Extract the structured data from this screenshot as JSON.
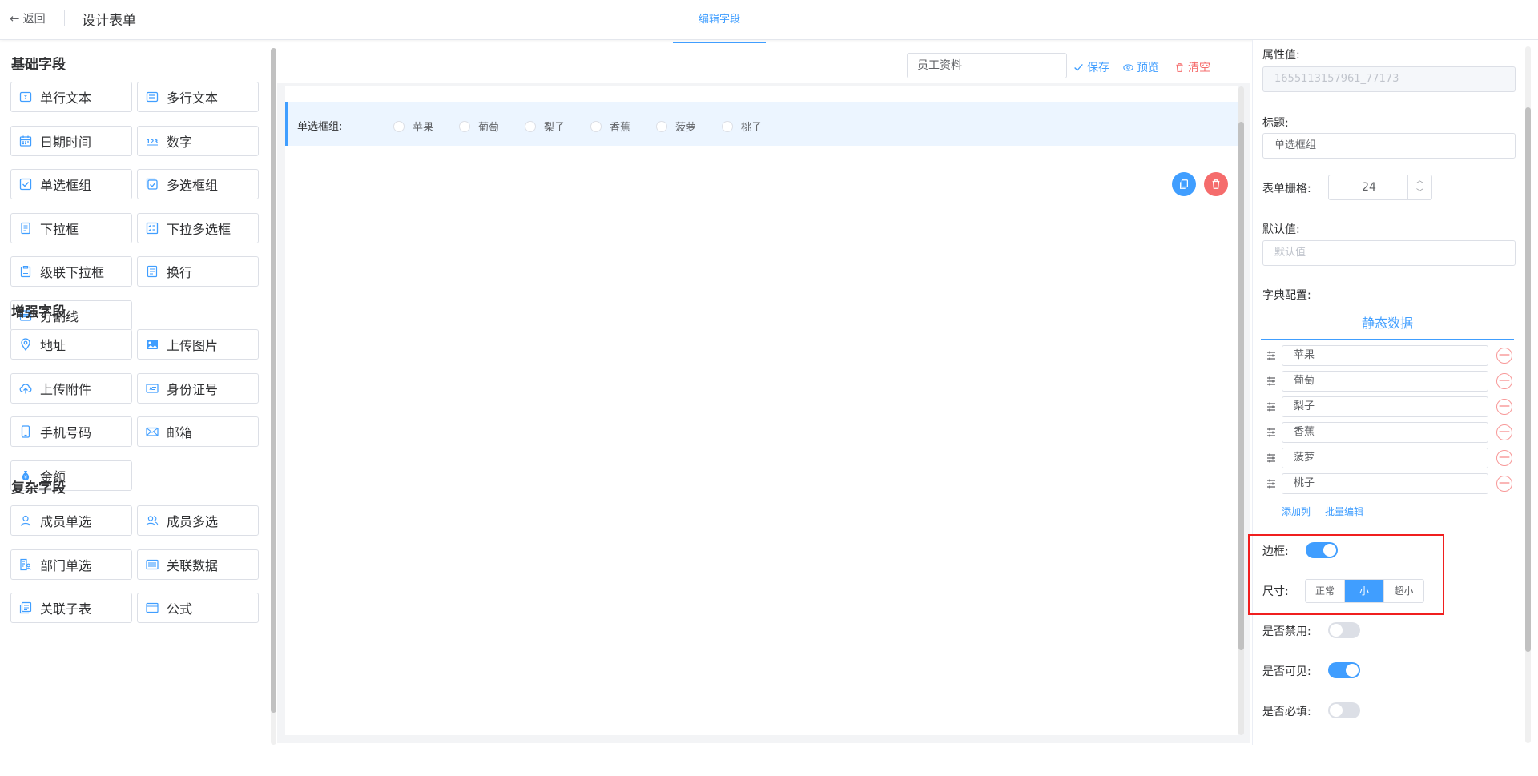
{
  "header": {
    "back_label": "返回",
    "page_title": "设计表单",
    "tab_label": "编辑字段"
  },
  "left": {
    "sections": [
      {
        "title": "基础字段",
        "items": [
          {
            "label": "单行文本",
            "icon": "text-input-icon"
          },
          {
            "label": "多行文本",
            "icon": "textarea-icon"
          },
          {
            "label": "日期时间",
            "icon": "calendar-icon"
          },
          {
            "label": "数字",
            "icon": "number-icon"
          },
          {
            "label": "单选框组",
            "icon": "radio-group-icon"
          },
          {
            "label": "多选框组",
            "icon": "checkbox-group-icon"
          },
          {
            "label": "下拉框",
            "icon": "select-icon"
          },
          {
            "label": "下拉多选框",
            "icon": "multi-select-icon"
          },
          {
            "label": "级联下拉框",
            "icon": "cascader-icon"
          },
          {
            "label": "换行",
            "icon": "line-break-icon"
          },
          {
            "label": "分割线",
            "icon": "divider-icon"
          }
        ]
      },
      {
        "title": "增强字段",
        "items": [
          {
            "label": "地址",
            "icon": "location-icon"
          },
          {
            "label": "上传图片",
            "icon": "image-icon"
          },
          {
            "label": "上传附件",
            "icon": "upload-cloud-icon"
          },
          {
            "label": "身份证号",
            "icon": "id-card-icon"
          },
          {
            "label": "手机号码",
            "icon": "phone-icon"
          },
          {
            "label": "邮箱",
            "icon": "mail-icon"
          },
          {
            "label": "金额",
            "icon": "money-bag-icon"
          }
        ]
      },
      {
        "title": "复杂字段",
        "items": [
          {
            "label": "成员单选",
            "icon": "user-icon"
          },
          {
            "label": "成员多选",
            "icon": "users-icon"
          },
          {
            "label": "部门单选",
            "icon": "department-icon"
          },
          {
            "label": "关联数据",
            "icon": "barcode-icon"
          },
          {
            "label": "关联子表",
            "icon": "sub-table-icon"
          },
          {
            "label": "公式",
            "icon": "formula-icon"
          }
        ]
      }
    ]
  },
  "toolbar": {
    "form_name": "员工资料",
    "save_label": "保存",
    "preview_label": "预览",
    "clear_label": "清空"
  },
  "canvas": {
    "field_label": "单选框组:",
    "options": [
      "苹果",
      "葡萄",
      "梨子",
      "香蕉",
      "菠萝",
      "桃子"
    ]
  },
  "props": {
    "attr_label": "属性值:",
    "attr_value": "1655113157961_77173",
    "title_label": "标题:",
    "title_value": "单选框组",
    "grid_label": "表单栅格:",
    "grid_value": "24",
    "default_label": "默认值:",
    "default_placeholder": "默认值",
    "dict_label": "字典配置:",
    "dict_tab": "静态数据",
    "dict_options": [
      "苹果",
      "葡萄",
      "梨子",
      "香蕉",
      "菠萝",
      "桃子"
    ],
    "add_col": "添加列",
    "batch_edit": "批量编辑",
    "border_label": "边框:",
    "border_on": true,
    "size_label": "尺寸:",
    "sizes": [
      "正常",
      "小",
      "超小"
    ],
    "size_selected": "小",
    "disabled_label": "是否禁用:",
    "disabled_on": false,
    "visible_label": "是否可见:",
    "visible_on": true,
    "required_label": "是否必填:",
    "required_on": false
  },
  "colors": {
    "primary": "#409eff",
    "danger": "#f56c6c",
    "highlight_box": "#f01f1f"
  }
}
